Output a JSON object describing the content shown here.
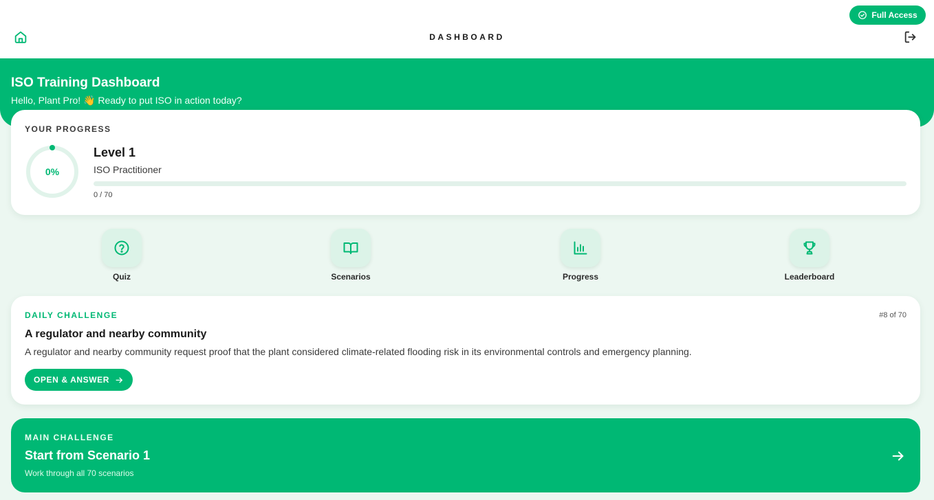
{
  "header": {
    "title": "DASHBOARD",
    "access_badge": "Full Access",
    "home_icon": "home-icon",
    "logout_icon": "logout-icon"
  },
  "hero": {
    "title": "ISO Training Dashboard",
    "greeting": "Hello, Plant Pro! 👋 Ready to put ISO in action today?"
  },
  "progress": {
    "section_label": "YOUR PROGRESS",
    "percent_label": "0%",
    "fraction": 0,
    "level": "Level 1",
    "rank": "ISO Practitioner",
    "count": "0 / 70"
  },
  "nav": {
    "items": [
      {
        "label": "Quiz",
        "icon": "question-circle-icon"
      },
      {
        "label": "Scenarios",
        "icon": "book-open-icon"
      },
      {
        "label": "Progress",
        "icon": "bar-chart-icon"
      },
      {
        "label": "Leaderboard",
        "icon": "trophy-icon"
      }
    ]
  },
  "daily": {
    "label": "DAILY CHALLENGE",
    "counter": "#8 of 70",
    "title": "A regulator and nearby community",
    "description": "A regulator and nearby community request proof that the plant considered climate-related flooding risk in its environmental controls and emergency planning.",
    "button_label": "OPEN & ANSWER"
  },
  "main": {
    "label": "MAIN CHALLENGE",
    "title": "Start from Scenario 1",
    "subtitle": "Work through all 70 scenarios"
  },
  "colors": {
    "accent": "#00b874",
    "page_background": "#ecf7f1",
    "icon_tile": "#dcf3e8",
    "track": "#e2f1ea"
  }
}
